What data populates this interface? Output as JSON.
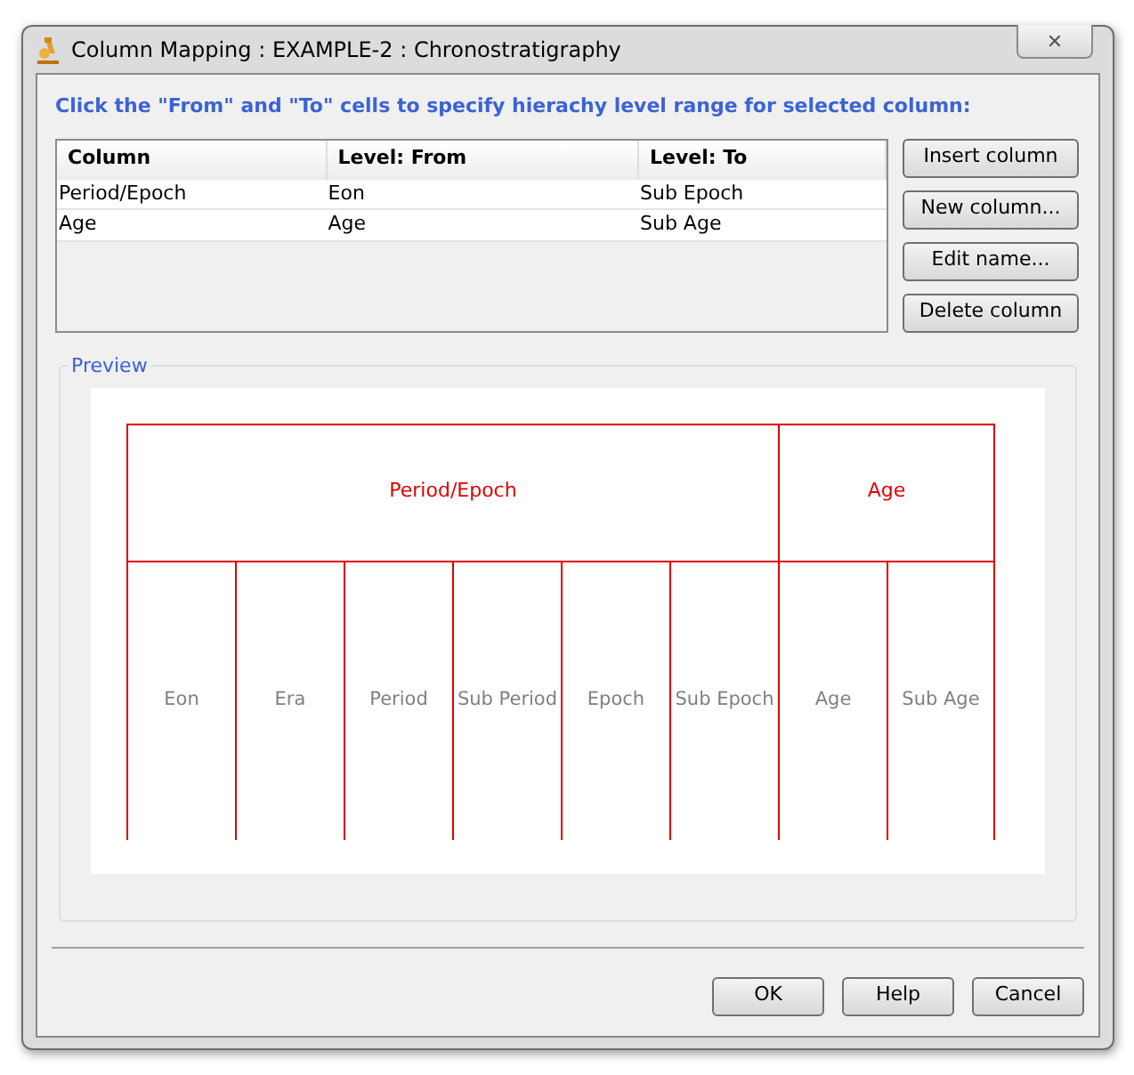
{
  "window": {
    "title": "Column Mapping : EXAMPLE-2 : Chronostratigraphy",
    "close": "✕"
  },
  "instruction": "Click the \"From\" and \"To\" cells to specify hierachy level range for selected column:",
  "table": {
    "columns": [
      "Column",
      "Level: From",
      "Level: To"
    ],
    "rows": [
      [
        "Period/Epoch",
        "Eon",
        "Sub Epoch"
      ],
      [
        "Age",
        "Age",
        "Sub Age"
      ]
    ]
  },
  "side_buttons": [
    "Insert column",
    "New column...",
    "Edit name...",
    "Delete column"
  ],
  "preview": {
    "label": "Preview",
    "groups": [
      {
        "name": "Period/Epoch",
        "levels": [
          "Eon",
          "Era",
          "Period",
          "Sub Period",
          "Epoch",
          "Sub Epoch"
        ]
      },
      {
        "name": "Age",
        "levels": [
          "Age",
          "Sub Age"
        ]
      }
    ]
  },
  "footer_buttons": [
    "OK",
    "Help",
    "Cancel"
  ]
}
